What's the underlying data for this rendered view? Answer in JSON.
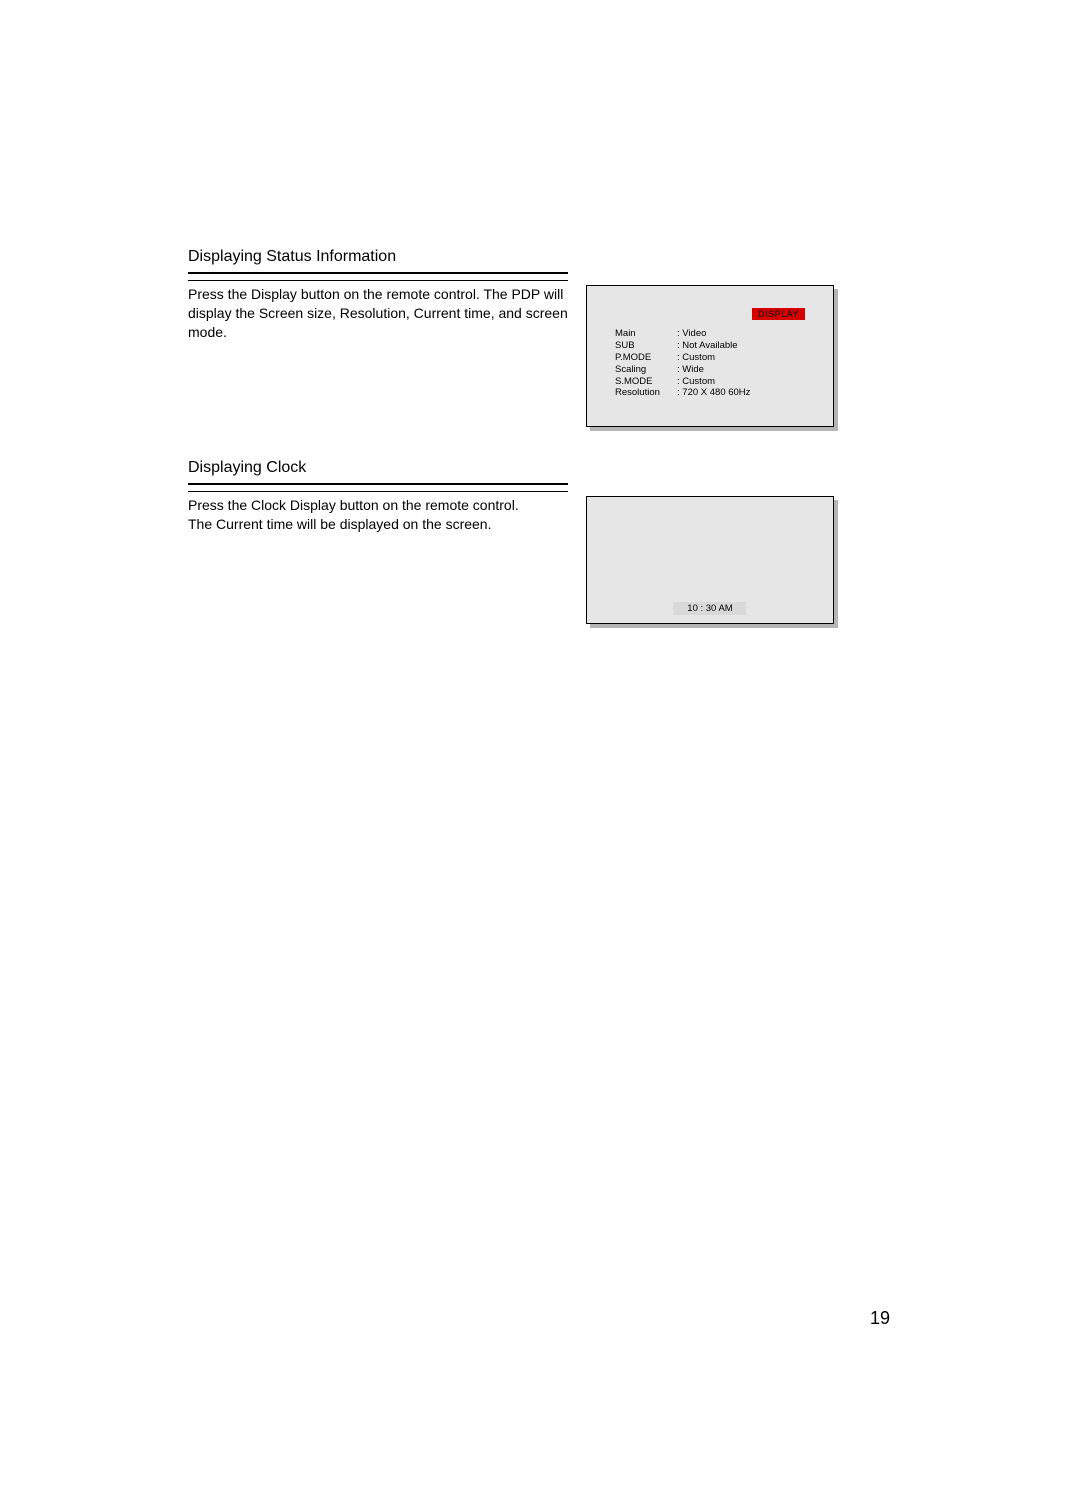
{
  "section1": {
    "heading": "Displaying Status Information",
    "body": "Press the Display button on the remote control. The PDP will display the Screen size, Resolution, Current time, and screen mode.",
    "osd": {
      "title": "DISPLAY",
      "rows": [
        {
          "label": "Main",
          "value": "Video"
        },
        {
          "label": "SUB",
          "value": "Not Available"
        },
        {
          "label": "P.MODE",
          "value": "Custom"
        },
        {
          "label": "Scaling",
          "value": "Wide"
        },
        {
          "label": "S.MODE",
          "value": "Custom"
        },
        {
          "label": "Resolution",
          "value": "720 X 480 60Hz"
        }
      ]
    }
  },
  "section2": {
    "heading": "Displaying Clock",
    "body": "Press the Clock Display button on the remote control.\nThe Current time will be displayed on the screen.",
    "clock_time": "10 : 30 AM"
  },
  "page_number": "19"
}
